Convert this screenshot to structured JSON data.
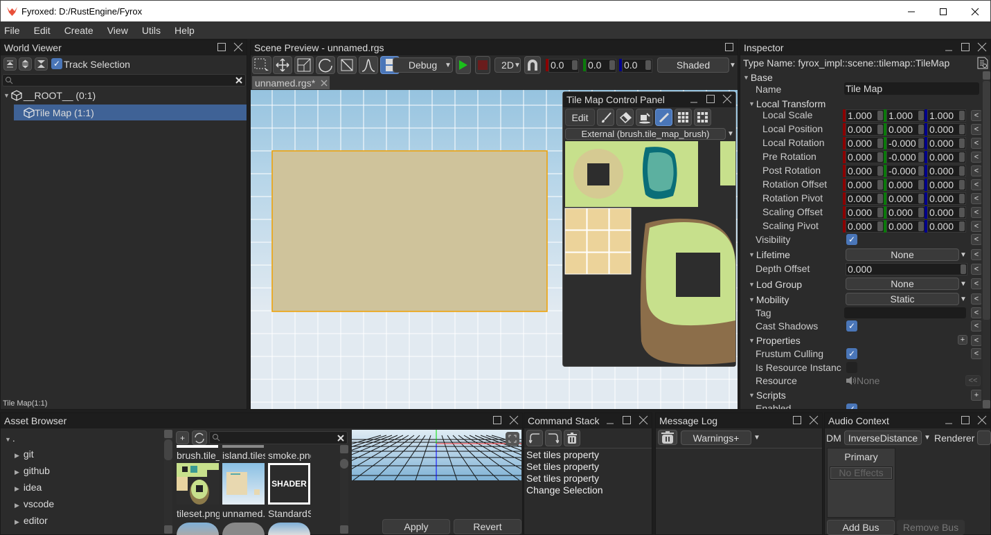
{
  "window": {
    "title": "Fyroxed: D:/RustEngine/Fyrox",
    "minimize": "minimize",
    "maximize": "maximize",
    "close": "close"
  },
  "menu": [
    "File",
    "Edit",
    "Create",
    "View",
    "Utils",
    "Help"
  ],
  "world_viewer": {
    "title": "World Viewer",
    "track_selection": "Track Selection",
    "track_selection_checked": true,
    "search_placeholder": "",
    "tree": [
      {
        "label": "__ROOT__ (0:1)",
        "expanded": true,
        "selected": false
      },
      {
        "label": "Tile Map (1:1)",
        "selected": true
      }
    ],
    "status": "Tile Map(1:1)"
  },
  "scene_preview": {
    "title": "Scene Preview - unnamed.rgs",
    "tab": "unnamed.rgs*",
    "build_profile": "Debug",
    "mode": "2D",
    "snap_x": "0.0",
    "snap_y": "0.0",
    "snap_z": "0.0",
    "render_mode": "Shaded"
  },
  "tile_panel": {
    "title": "Tile Map Control Panel",
    "edit": "Edit",
    "brush": "External (brush.tile_map_brush)"
  },
  "inspector": {
    "title": "Inspector",
    "type_name": "Type Name: fyrox_impl::scene::tilemap::TileMap",
    "base": "Base",
    "name_label": "Name",
    "name_value": "Tile Map",
    "local_transform": "Local Transform",
    "vectors": [
      {
        "label": "Local Scale",
        "x": "1.000",
        "y": "1.000",
        "z": "1.000"
      },
      {
        "label": "Local Position",
        "x": "0.000",
        "y": "0.000",
        "z": "0.000"
      },
      {
        "label": "Local Rotation",
        "x": "0.000",
        "y": "-0.000",
        "z": "0.000"
      },
      {
        "label": "Pre Rotation",
        "x": "0.000",
        "y": "-0.000",
        "z": "0.000"
      },
      {
        "label": "Post Rotation",
        "x": "0.000",
        "y": "-0.000",
        "z": "0.000"
      },
      {
        "label": "Rotation Offset",
        "x": "0.000",
        "y": "0.000",
        "z": "0.000"
      },
      {
        "label": "Rotation Pivot",
        "x": "0.000",
        "y": "0.000",
        "z": "0.000"
      },
      {
        "label": "Scaling Offset",
        "x": "0.000",
        "y": "0.000",
        "z": "0.000"
      },
      {
        "label": "Scaling Pivot",
        "x": "0.000",
        "y": "0.000",
        "z": "0.000"
      }
    ],
    "visibility": "Visibility",
    "lifetime": "Lifetime",
    "lifetime_value": "None",
    "depth_offset": "Depth Offset",
    "depth_offset_value": "0.000",
    "lod_group": "Lod Group",
    "lod_group_value": "None",
    "mobility": "Mobility",
    "mobility_value": "Static",
    "tag": "Tag",
    "tag_value": "",
    "cast_shadows": "Cast Shadows",
    "properties": "Properties",
    "frustum_culling": "Frustum Culling",
    "is_resource_instance": "Is Resource Instanc",
    "resource": "Resource",
    "resource_value": "None",
    "scripts": "Scripts",
    "enabled": "Enabled",
    "revert": "<",
    "revert_all": "<<",
    "add": "+"
  },
  "asset_browser": {
    "title": "Asset Browser",
    "root": ".",
    "folders": [
      "git",
      "github",
      "idea",
      "vscode",
      "editor"
    ],
    "files_row1": [
      "brush.tile_",
      "island.tiles",
      "smoke.png"
    ],
    "files_row2": [
      "tileset.png",
      "unnamed.",
      "StandardS"
    ],
    "shader_thumb": "SHADER",
    "apply": "Apply",
    "revert": "Revert"
  },
  "command_stack": {
    "title": "Command Stack",
    "items": [
      "Set tiles property",
      "Set tiles property",
      "Set tiles property",
      "Change Selection"
    ]
  },
  "message_log": {
    "title": "Message Log",
    "filter": "Warnings+"
  },
  "audio_context": {
    "title": "Audio Context",
    "dm_label": "DM",
    "dm_value": "InverseDistance",
    "renderer_label": "Renderer",
    "bus": "Primary",
    "no_effects": "No Effects",
    "add_bus": "Add Bus",
    "remove_bus": "Remove Bus"
  }
}
